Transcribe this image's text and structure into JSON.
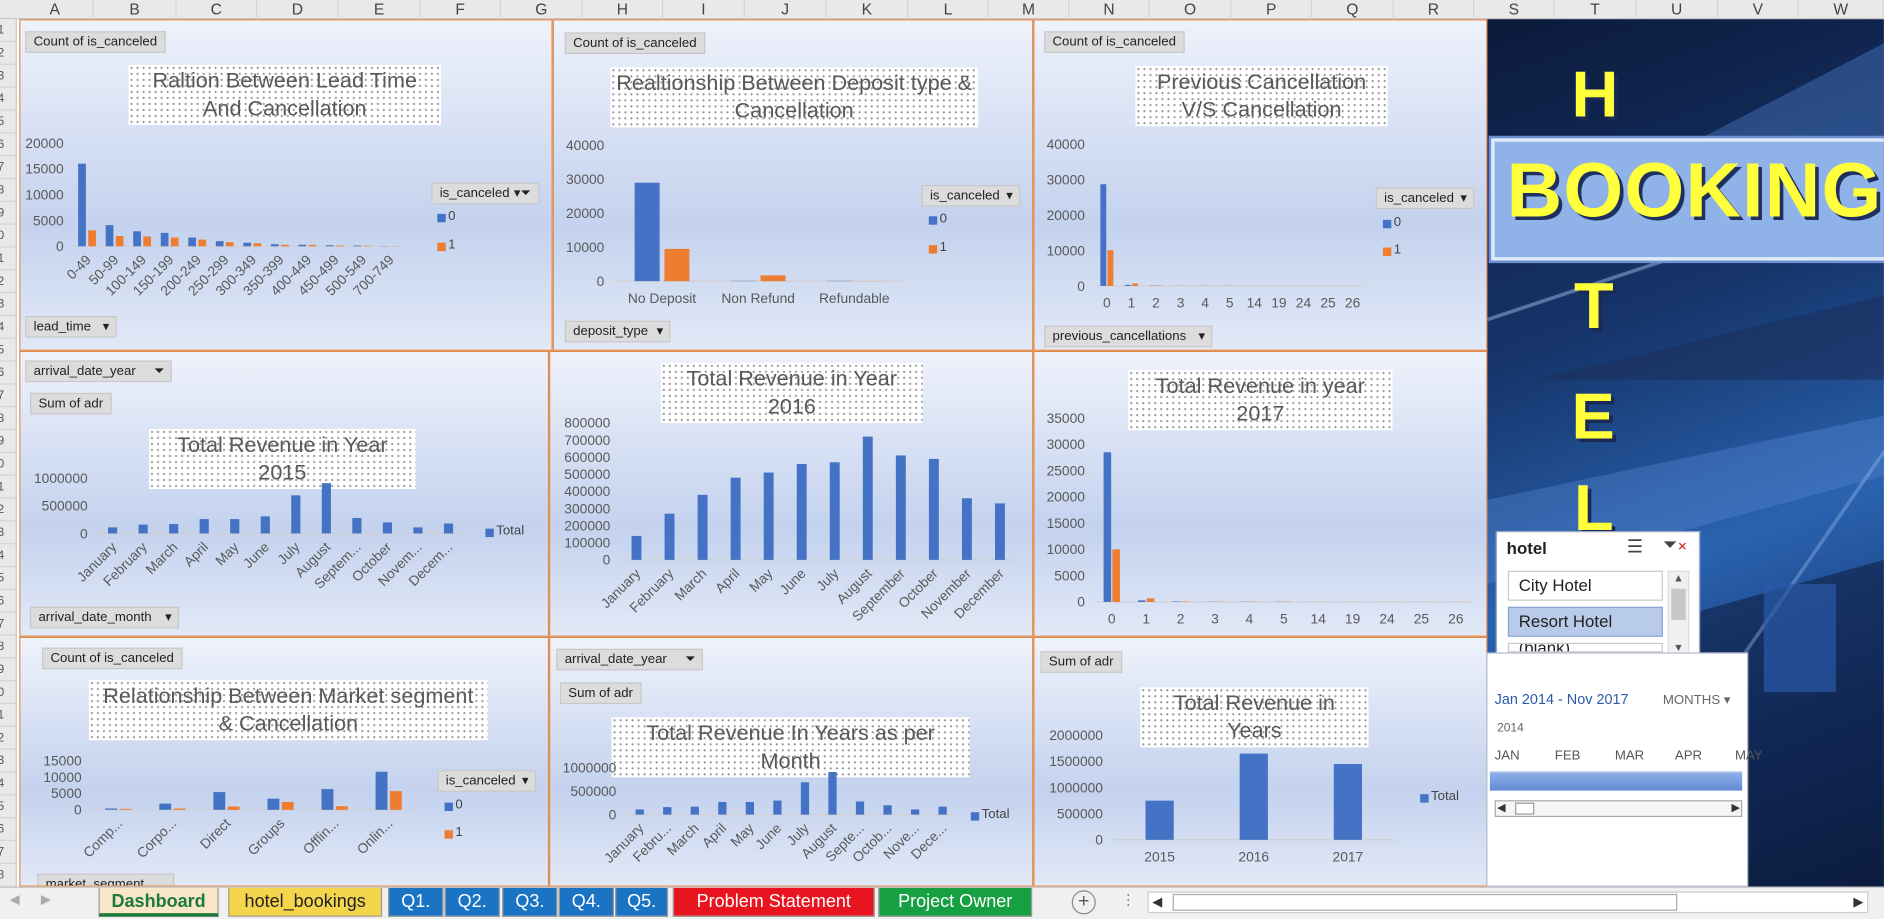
{
  "columns": [
    "A",
    "B",
    "C",
    "D",
    "E",
    "F",
    "G",
    "H",
    "I",
    "J",
    "K",
    "L",
    "M",
    "N",
    "O",
    "P",
    "Q",
    "R",
    "S",
    "T",
    "U",
    "V",
    "W"
  ],
  "rows": [
    "1",
    "2",
    "3",
    "4",
    "5",
    "6",
    "7",
    "8",
    "9",
    "0",
    "1",
    "2",
    "3",
    "4",
    "5",
    "6",
    "7",
    "8",
    "9",
    "0",
    "1",
    "2",
    "3",
    "4",
    "5",
    "6",
    "7",
    "8",
    "9",
    "0",
    "1",
    "2",
    "3",
    "4",
    "5",
    "6",
    "7",
    "8"
  ],
  "charts": [
    {
      "field": "Count of is_canceled",
      "title": "Raltion Between Lead Time And Cancellation",
      "axis_field": "lead_time",
      "legend_title": "is_canceled",
      "legend": [
        "0",
        "1"
      ]
    },
    {
      "field": "Count of is_canceled",
      "title": "Realtionship Between Deposit type & Cancellation",
      "axis_field": "deposit_type",
      "legend_title": "is_canceled",
      "legend": [
        "0",
        "1"
      ]
    },
    {
      "field": "Count of is_canceled",
      "title": "Previous Cancellation V/S Cancellation",
      "axis_field": "previous_cancellations",
      "legend_title": "is_canceled",
      "legend": [
        "0",
        "1"
      ]
    },
    {
      "field": "Sum of adr",
      "filter_field": "arrival_date_year",
      "title": "Total Revenue in Year 2015",
      "axis_field": "arrival_date_month",
      "legend": [
        "Total"
      ]
    },
    {
      "title": "Total Revenue in Year 2016"
    },
    {
      "title": "Total Revenue in year 2017"
    },
    {
      "field": "Count of is_canceled",
      "title": "Relationship Between Market segment & Cancellation",
      "axis_field": "market_segment",
      "legend_title": "is_canceled",
      "legend": [
        "0",
        "1"
      ]
    },
    {
      "field": "Sum of adr",
      "filter_field": "arrival_date_year",
      "title": "Total Revenue In Years as per Month",
      "legend": [
        "Total"
      ]
    },
    {
      "field": "Sum of adr",
      "title": "Total Revenue in Years",
      "legend": [
        "Total"
      ]
    }
  ],
  "chart_data": [
    {
      "type": "bar",
      "categories": [
        "0-49",
        "50-99",
        "100-149",
        "150-199",
        "200-249",
        "250-299",
        "300-349",
        "350-399",
        "400-449",
        "450-499",
        "500-549",
        "700-749"
      ],
      "series": [
        {
          "name": "0",
          "values": [
            16000,
            4100,
            2900,
            2600,
            1700,
            1000,
            700,
            400,
            300,
            200,
            150,
            50
          ]
        },
        {
          "name": "1",
          "values": [
            3100,
            2000,
            1900,
            1700,
            1300,
            800,
            600,
            300,
            250,
            150,
            100,
            30
          ]
        }
      ],
      "ylim": [
        0,
        20000
      ],
      "yticks": [
        0,
        5000,
        10000,
        15000,
        20000
      ],
      "title": "Raltion Between Lead Time And Cancellation",
      "xlabel": "lead_time",
      "ylabel": "Count of is_canceled"
    },
    {
      "type": "bar",
      "categories": [
        "No Deposit",
        "Non Refund",
        "Refundable"
      ],
      "series": [
        {
          "name": "0",
          "values": [
            29000,
            100,
            100
          ]
        },
        {
          "name": "1",
          "values": [
            9500,
            1700,
            50
          ]
        }
      ],
      "ylim": [
        0,
        40000
      ],
      "yticks": [
        0,
        10000,
        20000,
        30000,
        40000
      ],
      "title": "Realtionship Between Deposit type & Cancellation",
      "xlabel": "deposit_type",
      "ylabel": "Count of is_canceled"
    },
    {
      "type": "bar",
      "categories": [
        "0",
        "1",
        "2",
        "3",
        "4",
        "5",
        "14",
        "19",
        "24",
        "25",
        "26"
      ],
      "series": [
        {
          "name": "0",
          "values": [
            28700,
            300,
            100,
            50,
            50,
            50,
            20,
            20,
            20,
            20,
            20
          ]
        },
        {
          "name": "1",
          "values": [
            10100,
            700,
            100,
            50,
            50,
            50,
            30,
            30,
            30,
            30,
            30
          ]
        }
      ],
      "ylim": [
        0,
        40000
      ],
      "yticks": [
        0,
        10000,
        20000,
        30000,
        40000
      ],
      "title": "Previous Cancellation V/S Cancellation",
      "xlabel": "previous_cancellations",
      "ylabel": "Count of is_canceled"
    },
    {
      "type": "bar",
      "categories": [
        "January",
        "February",
        "March",
        "April",
        "May",
        "June",
        "July",
        "August",
        "Septem...",
        "October",
        "Novem...",
        "Decem..."
      ],
      "series": [
        {
          "name": "Total",
          "values": [
            110000,
            160000,
            170000,
            260000,
            260000,
            310000,
            690000,
            910000,
            280000,
            200000,
            110000,
            180000
          ]
        }
      ],
      "ylim": [
        0,
        1000000
      ],
      "yticks": [
        0,
        500000,
        1000000
      ],
      "title": "Total Revenue in Year 2015",
      "xlabel": "arrival_date_month",
      "ylabel": "Sum of adr"
    },
    {
      "type": "bar",
      "categories": [
        "January",
        "February",
        "March",
        "April",
        "May",
        "June",
        "July",
        "August",
        "September",
        "October",
        "November",
        "December"
      ],
      "series": [
        {
          "name": "Total",
          "values": [
            140000,
            270000,
            380000,
            480000,
            510000,
            560000,
            570000,
            720000,
            610000,
            590000,
            360000,
            330000
          ]
        }
      ],
      "ylim": [
        0,
        800000
      ],
      "yticks": [
        0,
        100000,
        200000,
        300000,
        400000,
        500000,
        600000,
        700000,
        800000
      ],
      "title": "Total Revenue in Year 2016"
    },
    {
      "type": "bar",
      "categories": [
        "0",
        "1",
        "2",
        "3",
        "4",
        "5",
        "14",
        "19",
        "24",
        "25",
        "26"
      ],
      "series": [
        {
          "name": "0",
          "values": [
            28500,
            300,
            100,
            50,
            50,
            50,
            20,
            20,
            20,
            20,
            20
          ]
        },
        {
          "name": "1",
          "values": [
            10000,
            700,
            100,
            50,
            50,
            50,
            30,
            30,
            30,
            30,
            30
          ]
        }
      ],
      "ylim": [
        0,
        35000
      ],
      "yticks": [
        0,
        5000,
        10000,
        15000,
        20000,
        25000,
        30000,
        35000
      ],
      "title": "Total Revenue in year 2017"
    },
    {
      "type": "bar",
      "categories": [
        "Comp...",
        "Corpo...",
        "Direct",
        "Groups",
        "Offlin...",
        "Onlin..."
      ],
      "series": [
        {
          "name": "0",
          "values": [
            400,
            1900,
            5400,
            3400,
            6300,
            11600
          ]
        },
        {
          "name": "1",
          "values": [
            300,
            400,
            1000,
            2400,
            1100,
            5700
          ]
        }
      ],
      "ylim": [
        0,
        15000
      ],
      "yticks": [
        0,
        5000,
        10000,
        15000
      ],
      "title": "Relationship Between Market segment & Cancellation",
      "xlabel": "market_segment",
      "ylabel": "Count of is_canceled"
    },
    {
      "type": "bar",
      "categories": [
        "January",
        "Febru...",
        "March",
        "April",
        "May",
        "June",
        "July",
        "August",
        "Septe...",
        "Octob...",
        "Nove...",
        "Dece..."
      ],
      "series": [
        {
          "name": "Total",
          "values": [
            110000,
            160000,
            170000,
            270000,
            270000,
            300000,
            690000,
            910000,
            280000,
            200000,
            110000,
            170000
          ]
        }
      ],
      "ylim": [
        0,
        1000000
      ],
      "yticks": [
        0,
        500000,
        1000000
      ],
      "title": "Total Revenue In Years as per Month",
      "ylabel": "Sum of adr"
    },
    {
      "type": "bar",
      "categories": [
        "2015",
        "2016",
        "2017"
      ],
      "series": [
        {
          "name": "Total",
          "values": [
            750000,
            1650000,
            1450000
          ]
        }
      ],
      "ylim": [
        0,
        2000000
      ],
      "yticks": [
        0,
        500000,
        1000000,
        1500000,
        2000000
      ],
      "title": "Total Revenue in Years",
      "ylabel": "Sum of adr"
    }
  ],
  "hotel_panel": {
    "letters": [
      "H",
      "T",
      "E",
      "L"
    ],
    "booking": "BOOKING"
  },
  "slicer": {
    "title": "hotel",
    "items": [
      "City Hotel",
      "Resort Hotel",
      "(blank)"
    ],
    "selected": "Resort Hotel"
  },
  "timeline": {
    "range": "Jan 2014 - Nov 2017",
    "level": "MONTHS",
    "year": "2014",
    "months": [
      "JAN",
      "FEB",
      "MAR",
      "APR",
      "MAY"
    ]
  },
  "tabs": [
    {
      "label": "Dashboard",
      "bg": "#f7e6c8",
      "fg": "#1e7a3c"
    },
    {
      "label": "hotel_bookings",
      "bg": "#f5d54c",
      "fg": "#222222"
    },
    {
      "label": "Q1.",
      "bg": "#1b73c4",
      "fg": "#ffffff"
    },
    {
      "label": "Q2.",
      "bg": "#1b73c4",
      "fg": "#ffffff"
    },
    {
      "label": "Q3.",
      "bg": "#1b73c4",
      "fg": "#ffffff"
    },
    {
      "label": "Q4.",
      "bg": "#1b73c4",
      "fg": "#ffffff"
    },
    {
      "label": "Q5.",
      "bg": "#1b73c4",
      "fg": "#ffffff"
    },
    {
      "label": "Problem Statement",
      "bg": "#e8141f",
      "fg": "#ffffff"
    },
    {
      "label": "Project Owner",
      "bg": "#17a043",
      "fg": "#ffffff"
    }
  ],
  "colors": {
    "series0": "#4472c4",
    "series1": "#ed7d31",
    "chart_border": "#e08a4a"
  }
}
